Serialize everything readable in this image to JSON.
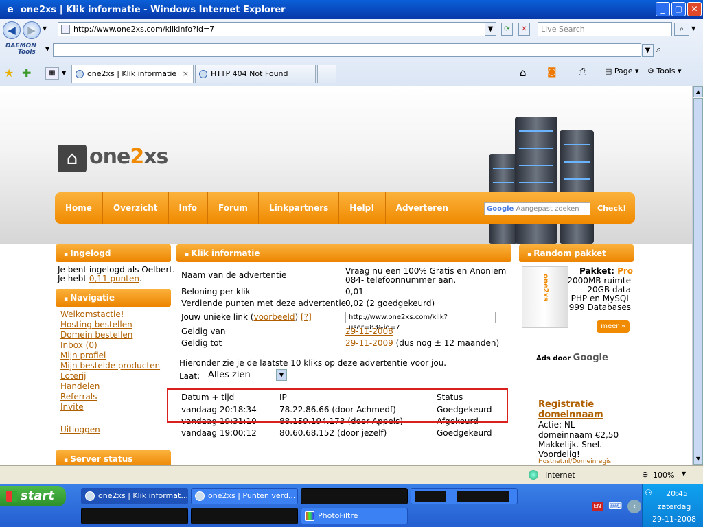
{
  "window": {
    "title": "one2xs | Klik informatie - Windows Internet Explorer"
  },
  "browser": {
    "address": "http://www.one2xs.com/klikinfo?id=7",
    "search_placeholder": "Live Search",
    "daemon_label_1": "DAEMON",
    "daemon_label_2": "Tools",
    "tabs": [
      {
        "label": "one2xs | Klik informatie",
        "close": "×"
      },
      {
        "label": "HTTP 404 Not Found"
      }
    ],
    "tools": {
      "page": "Page",
      "tools": "Tools"
    }
  },
  "site": {
    "logo": {
      "part1": "one",
      "part2": "2",
      "part3": "xs"
    },
    "menu": [
      "Home",
      "Overzicht",
      "Info",
      "Forum",
      "Linkpartners",
      "Help!",
      "Adverteren"
    ],
    "search": {
      "brand": "Google",
      "placeholder": "Aangepast zoeken",
      "button": "Check!"
    }
  },
  "sidebar": {
    "ingelogd": {
      "title": "Ingelogd",
      "line1": "Je bent ingelogd als Oelbert.",
      "line2_prefix": "Je hebt ",
      "points": "0,11 punten",
      "line2_suffix": "."
    },
    "navigatie": {
      "title": "Navigatie",
      "items": [
        "Welkomstactie!",
        "Hosting bestellen",
        "Domein bestellen",
        "Inbox (0)",
        "Mijn profiel",
        "Mijn bestelde producten",
        "Loterij",
        "Handelen",
        "Referrals",
        "Invite"
      ],
      "logout": "Uitloggen"
    },
    "server_status": {
      "title": "Server status"
    }
  },
  "main": {
    "title": "Klik informatie",
    "rows": [
      {
        "label": "Naam van de advertentie",
        "value1": "Vraag nu een 100% Gratis en Anoniem",
        "value2": "084- telefoonnummer aan."
      },
      {
        "label": "Beloning per klik",
        "value": "0,01"
      },
      {
        "label": "Verdiende punten met deze advertentie",
        "value": "0,02 (2 goedgekeurd)"
      },
      {
        "label_prefix": "Jouw unieke link (",
        "label_link": "voorbeeld",
        "label_suffix": ") ",
        "label_help": "[?]",
        "value": "http://www.one2xs.com/klik?user=83&id=7"
      },
      {
        "label": "Geldig van",
        "value": "29-11-2008"
      },
      {
        "label": "Geldig tot",
        "value": "29-11-2009",
        "value_suffix": " (dus nog ± 12 maanden)"
      }
    ],
    "intro": "Hieronder zie je de laatste 10 kliks op deze advertentie voor jou.",
    "filter_label": "Laat:",
    "filter_value": "Alles zien",
    "table": {
      "headers": [
        "Datum + tijd",
        "IP",
        "Status"
      ],
      "rows": [
        [
          "vandaag 20:18:34",
          "78.22.86.66 (door Achmedf)",
          "Goedgekeurd"
        ],
        [
          "vandaag 19:31:10",
          "88.159.194.173 (door Appels)",
          "Afgekeurd"
        ],
        [
          "vandaag 19:00:12",
          "80.60.68.152 (door jezelf)",
          "Goedgekeurd"
        ]
      ]
    }
  },
  "right": {
    "title": "Random pakket",
    "box_brand": "one2xs",
    "pakket_label": "Pakket: ",
    "pakket_value": "Pro",
    "lines": [
      "2000MB ruimte",
      "20GB data",
      "PHP en MySQL",
      "999 Databases"
    ],
    "meer": "meer »",
    "ads_prefix": "Ads door ",
    "ads_brand": "Google",
    "ad": {
      "title1": "Registratie",
      "title2": "domeinnaam",
      "lines": [
        "Actie: NL",
        "domeinnaam €2,50",
        "Makkelijk. Snel.",
        "Voordelig!"
      ],
      "url": "Hostnet.nl/Domeinregis"
    }
  },
  "statusbar": {
    "zone": "Internet",
    "zoom": "100%"
  },
  "taskbar": {
    "start": "start",
    "tasks": [
      "one2xs | Klik informat...",
      "one2xs | Punten verd...",
      "PhotoFiltre"
    ],
    "lang": "EN",
    "time": "20:45",
    "day": "zaterdag",
    "date": "29-11-2008"
  },
  "colors": {
    "accent": "#f08a00",
    "link": "#b06000",
    "highlight": "#d9201d",
    "title_blue": "#0a5fd8"
  }
}
